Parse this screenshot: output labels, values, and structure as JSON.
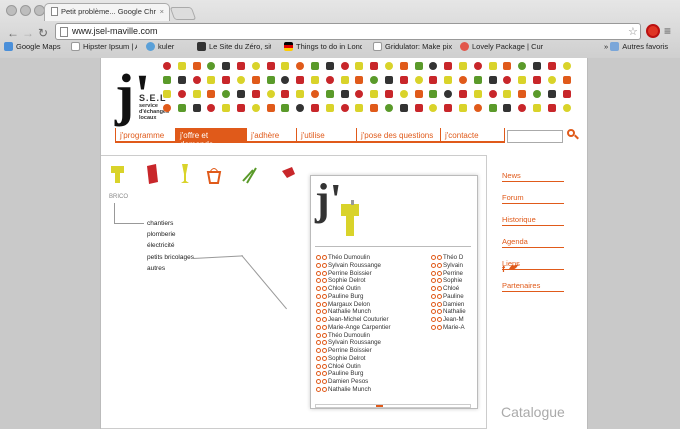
{
  "browser": {
    "tab_title": "Petit problème... Google Chr",
    "url": "www.jsel-maville.com",
    "bookmarks": [
      "Google Maps",
      "Hipster Ipsum | Artis",
      "kuler",
      "Le Site du Zéro, site",
      "Things to do in Lond",
      "Gridulator: Make pix",
      "Lovely Package | Cur"
    ],
    "other_bookmarks": "Autres favoris"
  },
  "site": {
    "logo_j": "j'",
    "logo_sel": "S.E.L",
    "logo_sub": "service d'échanges locaux",
    "nav": [
      "j'programme",
      "j'offre et demande",
      "j'adhère",
      "j'utilise",
      "j'pose des questions",
      "j'contacte"
    ],
    "category_label": "BRICO",
    "subcategories": [
      "chantiers",
      "plomberie",
      "électricité",
      "petits bricolages",
      "autres"
    ],
    "side_links": [
      "News",
      "Forum",
      "Historique",
      "Agenda",
      "Liens",
      "Partenaires"
    ],
    "social": "f",
    "catalogue": "Catalogue"
  },
  "popup": {
    "j": "j'",
    "names_col1": [
      "Théo Dumoulin",
      "Sylvain Roussange",
      "Perrine Boissier",
      "Sophie Delrot",
      "Chloé Outin",
      "Pauline Burg",
      "Margaux Delon",
      "Nathalie Munch",
      "Jean-Michel Couturier",
      "Marie-Ange Carpentier",
      "Théo Dumoulin",
      "Sylvain Roussange",
      "Perrine Boissier",
      "Sophie Delrot",
      "Chloé Outin",
      "Pauline Burg",
      "Damien Pesos",
      "Nathalie Munch"
    ],
    "names_col2": [
      "Théo D",
      "Sylvain",
      "Perrine",
      "Sophie",
      "Chloé",
      "Pauline",
      "Damien",
      "Nathalie",
      "Jean-M",
      "Marie-A"
    ]
  },
  "colors": {
    "accent": "#e05a1a",
    "yellow": "#d9d32a",
    "red": "#c8262a",
    "green": "#5a9a2a"
  }
}
